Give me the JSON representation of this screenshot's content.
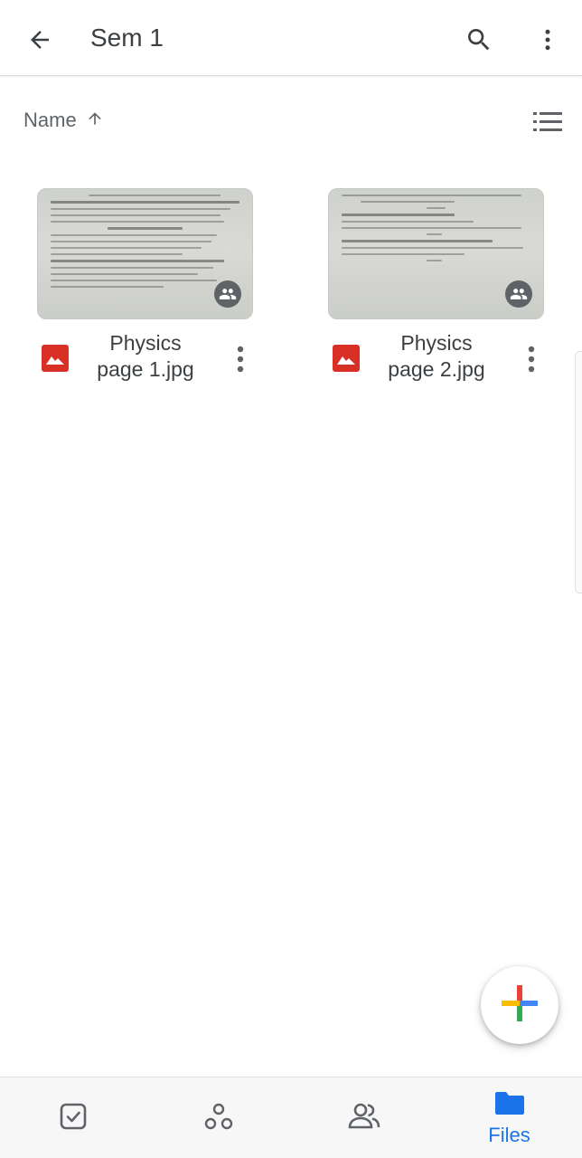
{
  "appbar": {
    "title": "Sem 1",
    "back_icon": "arrow-left-icon",
    "search_icon": "search-icon",
    "more_icon": "more-vert-icon"
  },
  "sort": {
    "label": "Name",
    "direction_icon": "arrow-up-icon",
    "view_toggle_icon": "list-view-icon"
  },
  "files": [
    {
      "name_line1": "Physics",
      "name_line2": "page 1.jpg",
      "type_icon": "image-icon",
      "shared_icon": "shared-people-icon"
    },
    {
      "name_line1": "Physics",
      "name_line2": "page 2.jpg",
      "type_icon": "image-icon",
      "shared_icon": "shared-people-icon"
    }
  ],
  "fab": {
    "icon": "plus-icon"
  },
  "bottom_nav": {
    "items": [
      {
        "icon": "priority-check-icon",
        "label": ""
      },
      {
        "icon": "workspaces-icon",
        "label": ""
      },
      {
        "icon": "shared-icon",
        "label": ""
      },
      {
        "icon": "folder-icon",
        "label": "Files",
        "active": true
      }
    ]
  },
  "colors": {
    "accent": "#1a73e8",
    "image_icon": "#d93025",
    "text": "#3c4043",
    "muted": "#5f6368"
  }
}
